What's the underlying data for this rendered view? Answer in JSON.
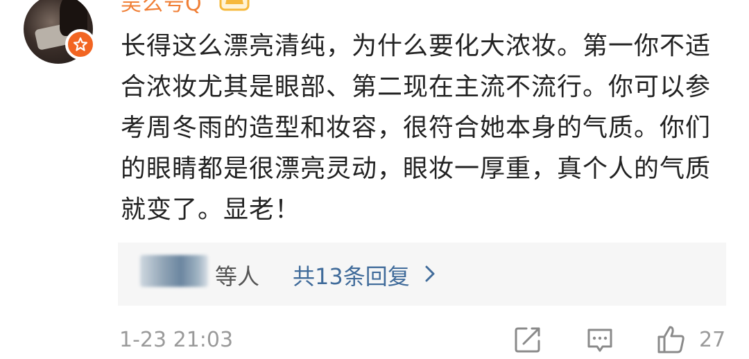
{
  "comment": {
    "author": {
      "name": "吴么号Q",
      "verified_badge_color": "#f26522",
      "crown_color": "#f6b83b"
    },
    "text": "长得这么漂亮清纯，为什么要化大浓妆。第一你不适合浓妆尤其是眼部、第二现在主流不流行。你可以参考周冬雨的造型和妆容，很符合她本身的气质。你们的眼睛都是很漂亮灵动，眼妆一厚重，真个人的气质就变了。显老！",
    "replies": {
      "who_suffix": "等人",
      "count_label": "共13条回复"
    },
    "timestamp": "1-23 21:03",
    "like_count": "27",
    "icons": [
      "share-icon",
      "comment-icon",
      "like-icon",
      "chevron-right-icon",
      "crown-icon",
      "verified-badge-icon"
    ]
  }
}
